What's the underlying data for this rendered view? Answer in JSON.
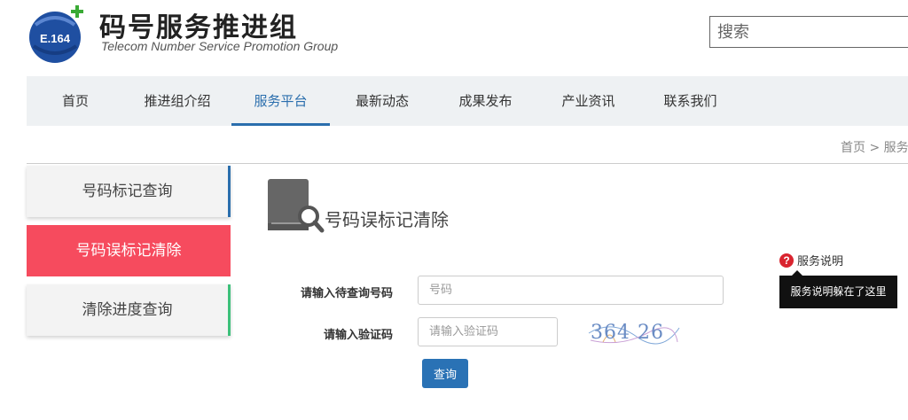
{
  "brand": {
    "logo_text": "E.164",
    "title": "码号服务推进组",
    "subtitle": "Telecom Number Service  Promotion Group"
  },
  "search": {
    "placeholder": "搜索"
  },
  "nav": {
    "items": [
      "首页",
      "推进组介绍",
      "服务平台",
      "最新动态",
      "成果发布",
      "产业资讯",
      "联系我们"
    ],
    "active": "服务平台"
  },
  "breadcrumb": "首页 > 服务",
  "sidebar": {
    "items": [
      "号码标记查询",
      "号码误标记清除",
      "清除进度查询"
    ],
    "active": "号码误标记清除"
  },
  "main": {
    "title": "号码误标记清除",
    "help_label": "服务说明",
    "tooltip": "服务说明躲在了这里",
    "form": {
      "phone_label": "请输入待查询号码",
      "phone_placeholder": "号码",
      "code_label": "请输入验证码",
      "code_placeholder": "请输入验证码",
      "captcha_text": "364 26",
      "submit_label": "查询"
    }
  },
  "colors": {
    "accent": "#2a6ead",
    "active_side": "#f64b5e",
    "green_bar": "#3cc07a",
    "logo_blue": "#1f4fa1",
    "logo_cross": "#3aaa35"
  }
}
